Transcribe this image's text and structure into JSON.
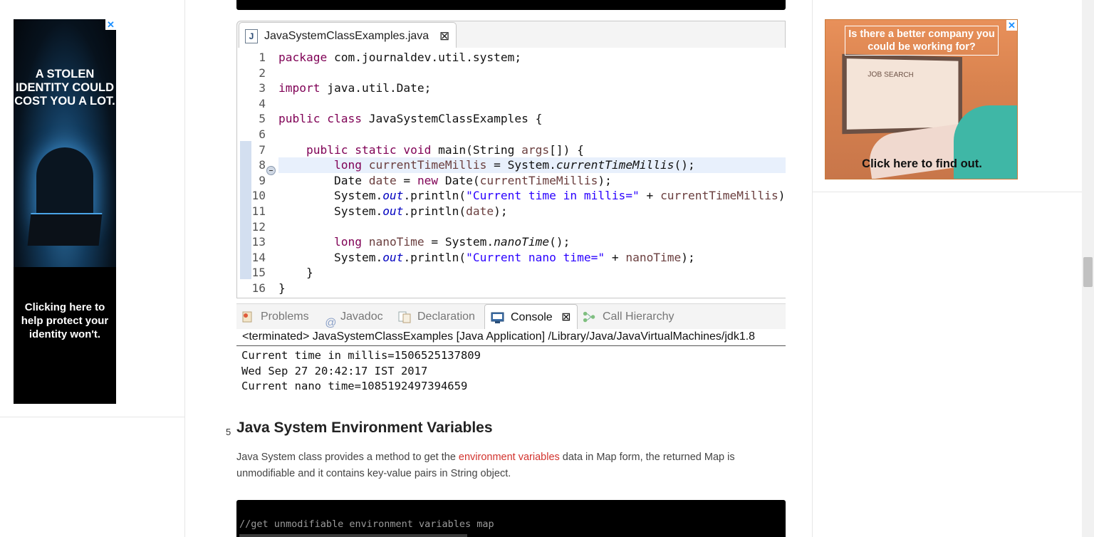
{
  "ads": {
    "left": {
      "headline": "A STOLEN IDENTITY COULD COST YOU A LOT.",
      "tagline": "Clicking here to help protect your identity won't.",
      "close": "✕"
    },
    "right": {
      "headline": "Is there a better company you could be working for?",
      "screen_text": "JOB SEARCH",
      "cta": "Click here to find out.",
      "close": "✕"
    }
  },
  "editor": {
    "tab_name": "JavaSystemClassExamples.java",
    "tab_close": "⊠",
    "file_icon": "J",
    "highlight_line": 8
  },
  "code_lines": [
    {
      "n": "1"
    },
    {
      "n": "2"
    },
    {
      "n": "3"
    },
    {
      "n": "4"
    },
    {
      "n": "5"
    },
    {
      "n": "6"
    },
    {
      "n": "7"
    },
    {
      "n": "8"
    },
    {
      "n": "9"
    },
    {
      "n": "10"
    },
    {
      "n": "11"
    },
    {
      "n": "12"
    },
    {
      "n": "13"
    },
    {
      "n": "14"
    },
    {
      "n": "15"
    },
    {
      "n": "16"
    }
  ],
  "views": {
    "problems": "Problems",
    "javadoc": "Javadoc",
    "declaration": "Declaration",
    "console": "Console",
    "call_hierarchy": "Call Hierarchy"
  },
  "console": {
    "status": "<terminated> JavaSystemClassExamples [Java Application] /Library/Java/JavaVirtualMachines/jdk1.8",
    "output": "Current time in millis=1506525137809\nWed Sep 27 20:42:17 IST 2017\nCurrent nano time=1085192497394659"
  },
  "section": {
    "number": "5",
    "title": "Java System Environment Variables",
    "para_before": "Java System class provides a method to get the ",
    "link": "environment variables",
    "para_after": " data in Map form, the returned Map is unmodifiable and it contains key-value pairs in String object."
  },
  "code_block": {
    "comment": "//get unmodifiable environment variables map"
  }
}
